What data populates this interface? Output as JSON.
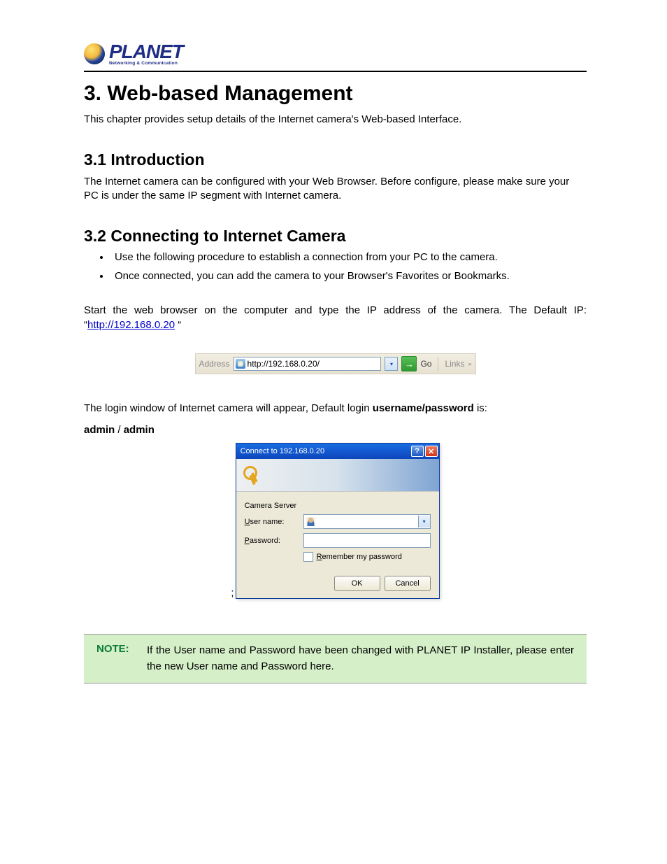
{
  "logo": {
    "brand": "PLANET",
    "tagline": "Networking & Communication"
  },
  "chapter": {
    "title": "3. Web-based Management",
    "intro": "This chapter provides setup details of the Internet camera's Web-based Interface."
  },
  "section_intro": {
    "heading": "3.1 Introduction",
    "body": "The Internet camera can be configured with your Web Browser. Before configure, please make sure your PC is under the same IP segment with Internet camera."
  },
  "section_connect": {
    "heading": "3.2 Connecting to Internet Camera",
    "bullets": [
      "Use the following procedure to establish a connection from your PC to the camera.",
      "Once connected, you can add the camera to your Browser's Favorites or Bookmarks."
    ],
    "start_prefix": "Start the web browser on the computer and type the IP address of the camera. The Default IP: “",
    "start_link": "http://192.168.0.20",
    "start_suffix": " “"
  },
  "addrbar": {
    "label": "Address",
    "url": "http://192.168.0.20/",
    "dropdown_glyph": "▾",
    "go_glyph": "→",
    "go_label": "Go",
    "links_label": "Links",
    "chev_glyph": "»"
  },
  "login": {
    "intro_prefix": "The login window of Internet camera will appear, Default login ",
    "intro_bold": "username/password",
    "intro_suffix": " is:",
    "cred_user": "admin",
    "cred_slash": " / ",
    "cred_pass": "admin"
  },
  "dialog": {
    "title": "Connect to 192.168.0.20",
    "help_glyph": "?",
    "close_glyph": "✕",
    "server_label": "Camera Server",
    "username_prefix": "U",
    "username_rest": "ser name:",
    "password_prefix": "P",
    "password_rest": "assword:",
    "dropdown_glyph": "▾",
    "remember_prefix": "R",
    "remember_rest": "emember my password",
    "ok": "OK",
    "cancel": "Cancel",
    "semicolon": ";"
  },
  "note": {
    "label": "NOTE:",
    "text": "If the User name and Password have been changed with PLANET IP Installer, please enter the new User name and Password here."
  }
}
